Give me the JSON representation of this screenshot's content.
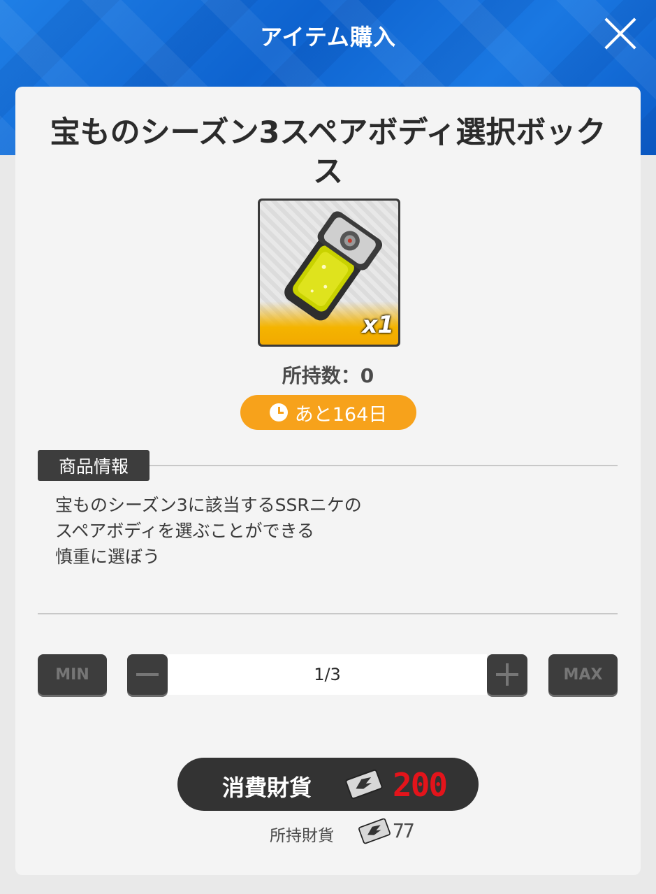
{
  "header": {
    "title": "アイテム購入",
    "close_icon": "close-icon"
  },
  "item": {
    "title": "宝ものシーズン3スペアボディ選択ボックス",
    "quantity_badge": "x1",
    "owned": "所持数：0",
    "timer_text": "あと164日",
    "timer_icon": "clock-icon",
    "accent": "#f7a21b"
  },
  "info": {
    "section_label": "商品情報",
    "description": [
      "宝ものシーズン3に該当するSSRニケの",
      "スペアボディを選ぶことができる",
      "慎重に選ぼう"
    ]
  },
  "stepper": {
    "min_label": "MIN",
    "max_label": "MAX",
    "value": "1/3"
  },
  "purchase": {
    "cost_label": "消費財貨",
    "cost_value": "200",
    "cost_color": "#e3141b",
    "held_label": "所持財貨",
    "held_value": "77",
    "currency_icon": "ticket-icon"
  }
}
